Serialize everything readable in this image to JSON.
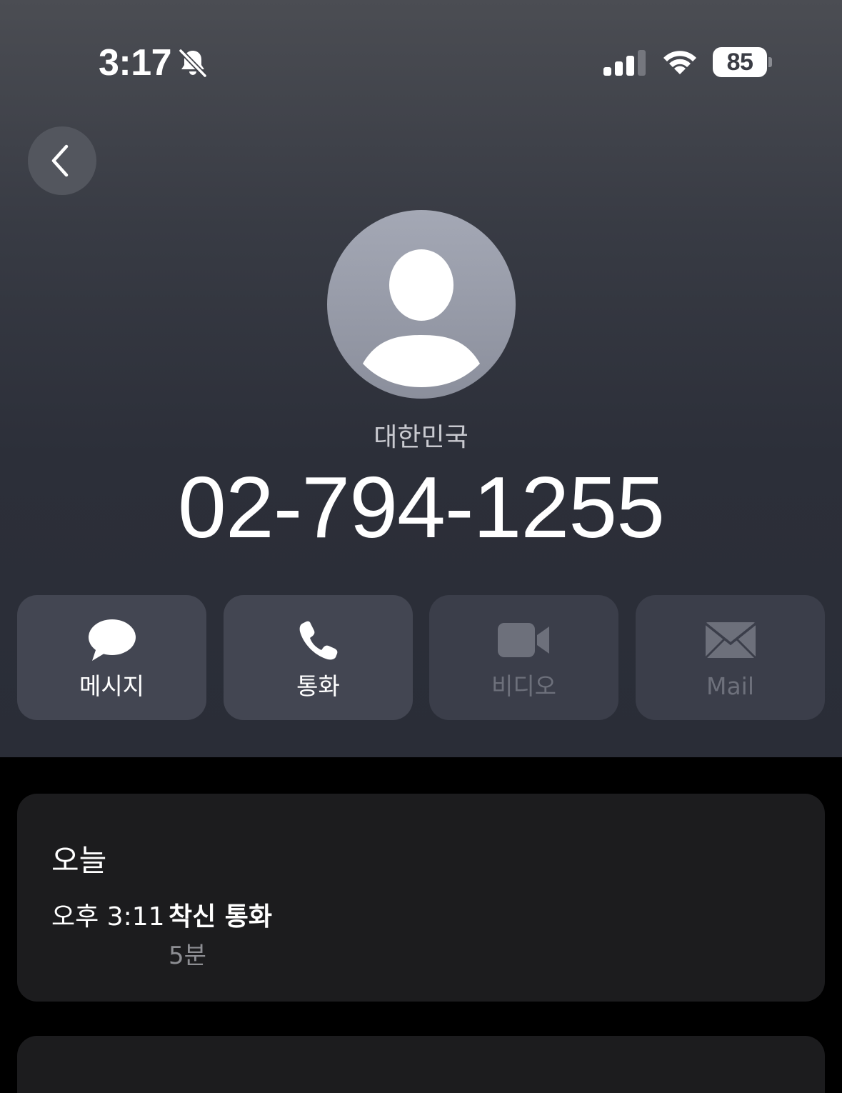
{
  "status_bar": {
    "time": "3:17",
    "battery": "85",
    "icons": [
      "bell-slash-icon",
      "cellular-signal-icon",
      "wifi-icon",
      "battery-icon"
    ]
  },
  "contact": {
    "country": "대한민국",
    "phone": "02-794-1255"
  },
  "actions": [
    {
      "label": "메시지",
      "icon": "message-bubble-icon",
      "enabled": true
    },
    {
      "label": "통화",
      "icon": "phone-icon",
      "enabled": true
    },
    {
      "label": "비디오",
      "icon": "video-camera-icon",
      "enabled": false
    },
    {
      "label": "Mail",
      "icon": "envelope-icon",
      "enabled": false
    }
  ],
  "history": {
    "day": "오늘",
    "entries": [
      {
        "time": "오후 3:11",
        "type": "착신 통화",
        "duration": "5분"
      }
    ]
  },
  "colors": {
    "header_top": "#4b4d53",
    "header_bottom": "#2a2d37",
    "button_bg": "#434652",
    "card_bg": "#1c1c1e",
    "secondary_text": "#8d8e93"
  }
}
